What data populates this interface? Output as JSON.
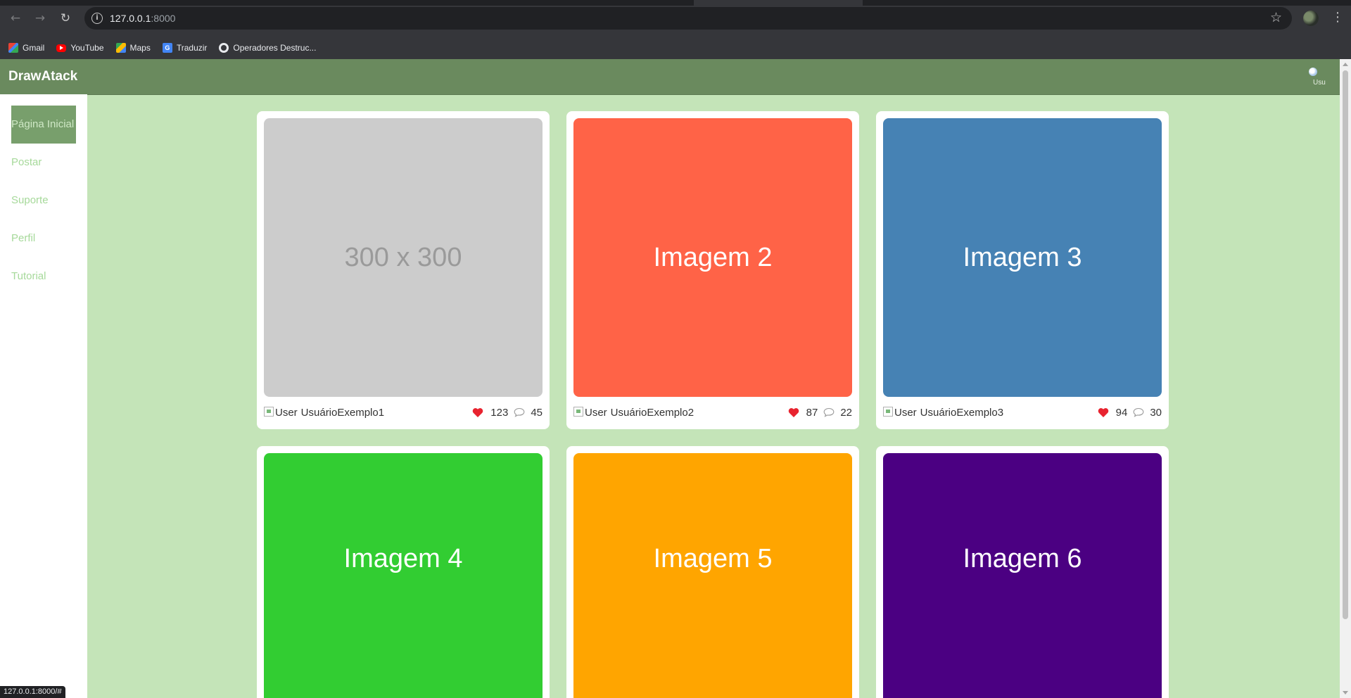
{
  "browser": {
    "url_host": "127.0.0.1",
    "url_port": ":8000",
    "bookmarks": [
      {
        "label": "Gmail",
        "icon": "gmail-icon"
      },
      {
        "label": "YouTube",
        "icon": "youtube-icon"
      },
      {
        "label": "Maps",
        "icon": "maps-icon"
      },
      {
        "label": "Traduzir",
        "icon": "translate-icon"
      },
      {
        "label": "Operadores Destruc...",
        "icon": "globe-icon"
      }
    ],
    "status_url": "127.0.0.1:8000/#"
  },
  "app": {
    "title": "DrawAtack",
    "avatar_alt": "Usu"
  },
  "sidebar": {
    "items": [
      {
        "label": "Página Inicial",
        "active": true
      },
      {
        "label": "Postar"
      },
      {
        "label": "Suporte"
      },
      {
        "label": "Perfil"
      },
      {
        "label": "Tutorial"
      }
    ]
  },
  "colors": {
    "header": "#6a8a5e",
    "background": "#c4e4b8",
    "nav_text": "#a6d99a",
    "nav_active": "#789f6c"
  },
  "posts": [
    {
      "image_text": "300 x 300",
      "image_color": "#cccccc",
      "user_alt": "User",
      "username": "UsuárioExemplo1",
      "likes": "123",
      "comments": "45"
    },
    {
      "image_text": "Imagem 2",
      "image_color": "#ff6347",
      "user_alt": "User",
      "username": "UsuárioExemplo2",
      "likes": "87",
      "comments": "22"
    },
    {
      "image_text": "Imagem 3",
      "image_color": "#4682b4",
      "user_alt": "User",
      "username": "UsuárioExemplo3",
      "likes": "94",
      "comments": "30"
    },
    {
      "image_text": "Imagem 4",
      "image_color": "#32cd32"
    },
    {
      "image_text": "Imagem 5",
      "image_color": "#ffa500"
    },
    {
      "image_text": "Imagem 6",
      "image_color": "#4b0082"
    }
  ]
}
